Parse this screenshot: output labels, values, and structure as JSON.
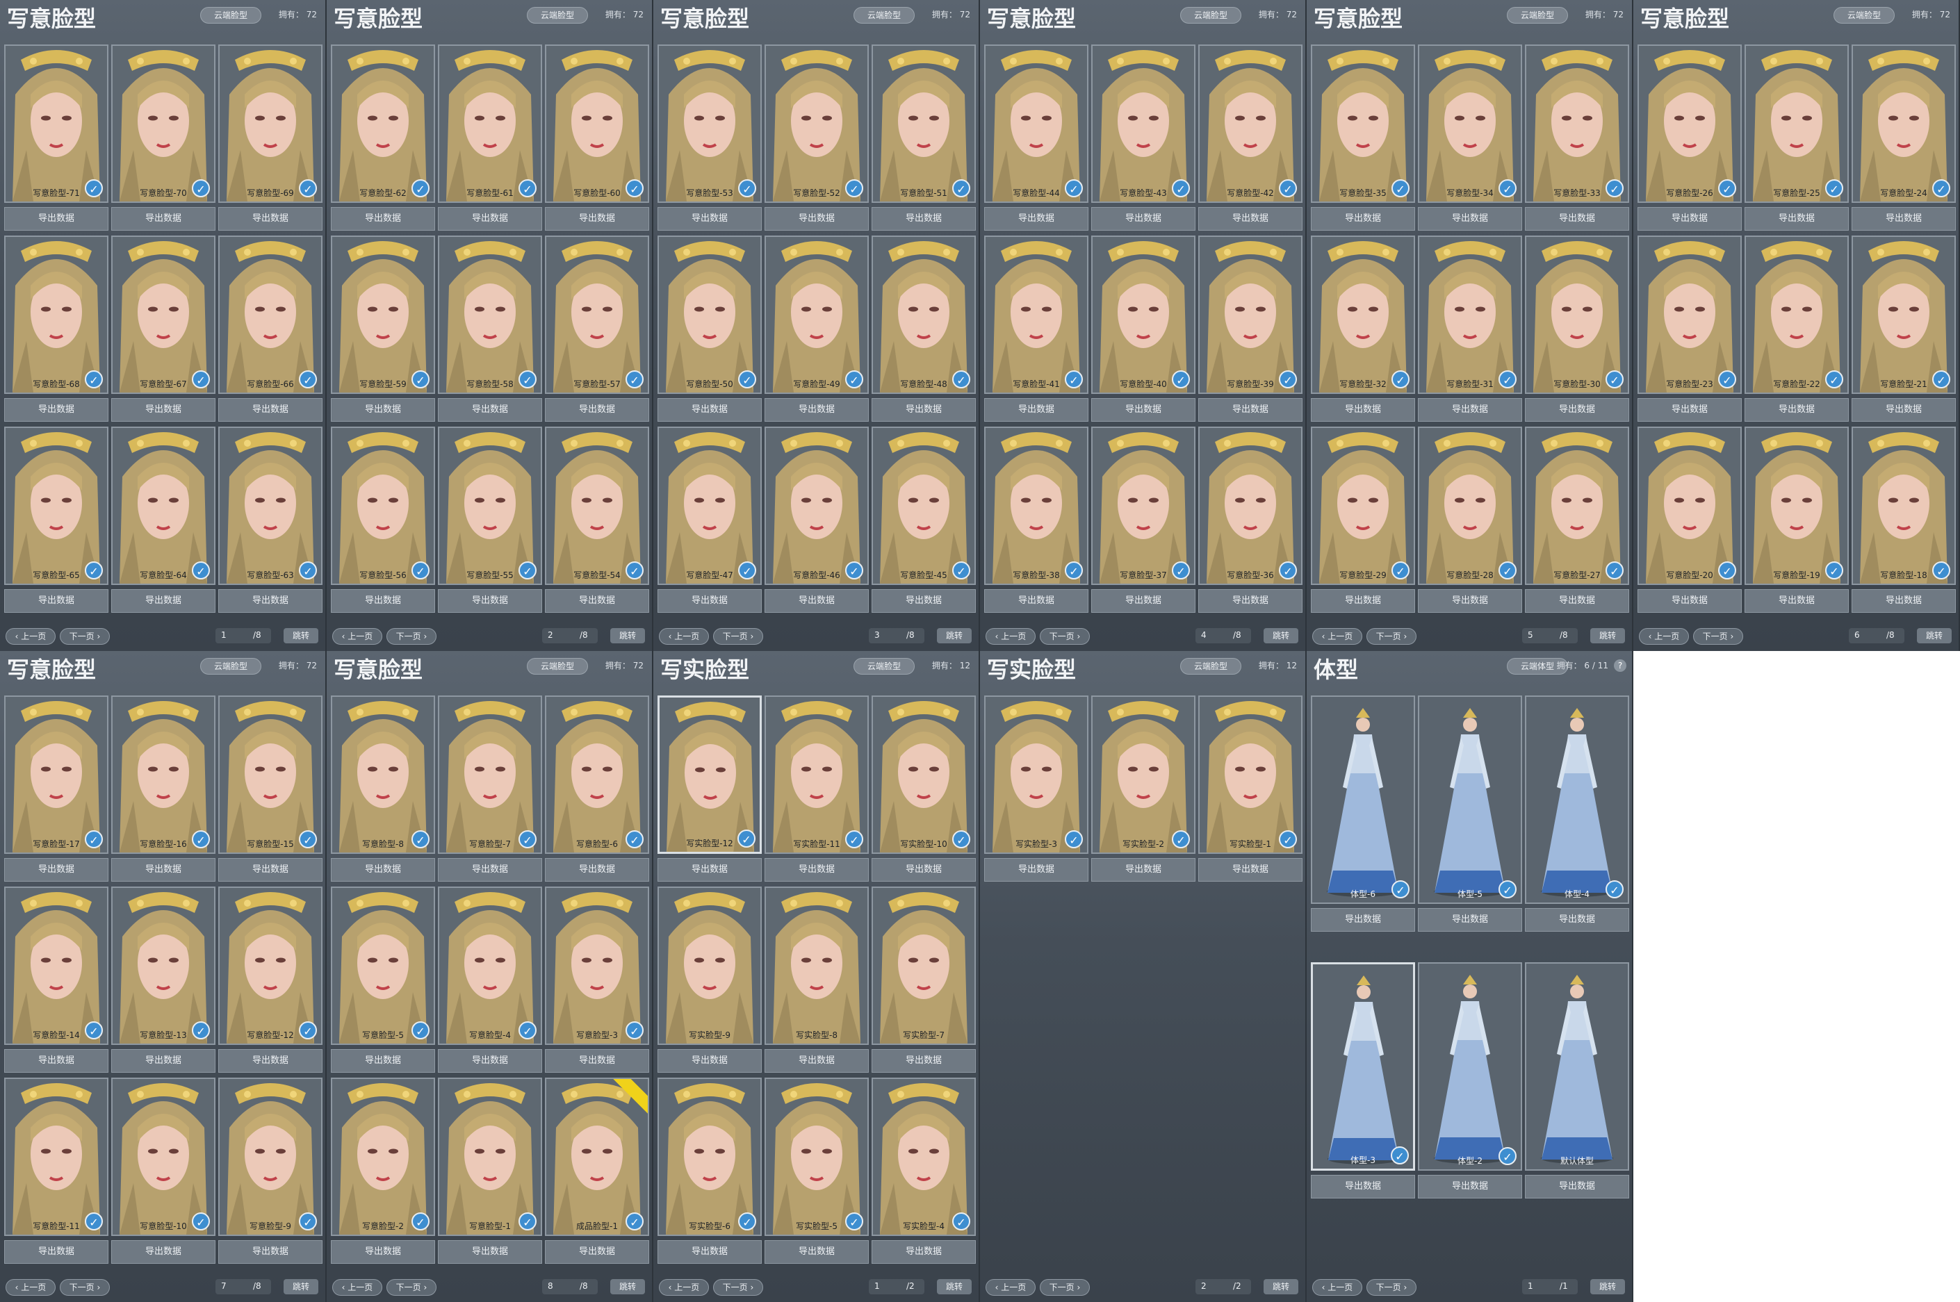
{
  "common": {
    "cloud_face_label": "云端脸型",
    "cloud_body_label": "云端体型",
    "export_label": "导出数据",
    "prev_label": "上一页",
    "next_label": "下一页",
    "jump_label": "跳转"
  },
  "colors": {
    "panel_top": "#5b6570",
    "panel_bottom": "#3a424b",
    "check_blue": "#3e8ed0",
    "new_badge": "#f0d21a"
  },
  "panels": [
    {
      "title": "写意脸型",
      "owned": "拥有： 72",
      "page": "1",
      "total": "/8",
      "type": "face",
      "items": [
        {
          "label": "写意脸型-71",
          "checked": true
        },
        {
          "label": "写意脸型-70",
          "checked": true
        },
        {
          "label": "写意脸型-69",
          "checked": true
        },
        {
          "label": "写意脸型-68",
          "checked": true
        },
        {
          "label": "写意脸型-67",
          "checked": true
        },
        {
          "label": "写意脸型-66",
          "checked": true
        },
        {
          "label": "写意脸型-65",
          "checked": true
        },
        {
          "label": "写意脸型-64",
          "checked": true
        },
        {
          "label": "写意脸型-63",
          "checked": true
        }
      ]
    },
    {
      "title": "写意脸型",
      "owned": "拥有： 72",
      "page": "2",
      "total": "/8",
      "type": "face",
      "items": [
        {
          "label": "写意脸型-62",
          "checked": true
        },
        {
          "label": "写意脸型-61",
          "checked": true
        },
        {
          "label": "写意脸型-60",
          "checked": true
        },
        {
          "label": "写意脸型-59",
          "checked": true
        },
        {
          "label": "写意脸型-58",
          "checked": true
        },
        {
          "label": "写意脸型-57",
          "checked": true
        },
        {
          "label": "写意脸型-56",
          "checked": true
        },
        {
          "label": "写意脸型-55",
          "checked": true
        },
        {
          "label": "写意脸型-54",
          "checked": true
        }
      ]
    },
    {
      "title": "写意脸型",
      "owned": "拥有： 72",
      "page": "3",
      "total": "/8",
      "type": "face",
      "items": [
        {
          "label": "写意脸型-53",
          "checked": true
        },
        {
          "label": "写意脸型-52",
          "checked": true
        },
        {
          "label": "写意脸型-51",
          "checked": true
        },
        {
          "label": "写意脸型-50",
          "checked": true
        },
        {
          "label": "写意脸型-49",
          "checked": true
        },
        {
          "label": "写意脸型-48",
          "checked": true
        },
        {
          "label": "写意脸型-47",
          "checked": true
        },
        {
          "label": "写意脸型-46",
          "checked": true
        },
        {
          "label": "写意脸型-45",
          "checked": true
        }
      ]
    },
    {
      "title": "写意脸型",
      "owned": "拥有： 72",
      "page": "4",
      "total": "/8",
      "type": "face",
      "items": [
        {
          "label": "写意脸型-44",
          "checked": true
        },
        {
          "label": "写意脸型-43",
          "checked": true
        },
        {
          "label": "写意脸型-42",
          "checked": true
        },
        {
          "label": "写意脸型-41",
          "checked": true
        },
        {
          "label": "写意脸型-40",
          "checked": true
        },
        {
          "label": "写意脸型-39",
          "checked": true
        },
        {
          "label": "写意脸型-38",
          "checked": true
        },
        {
          "label": "写意脸型-37",
          "checked": true
        },
        {
          "label": "写意脸型-36",
          "checked": true
        }
      ]
    },
    {
      "title": "写意脸型",
      "owned": "拥有： 72",
      "page": "5",
      "total": "/8",
      "type": "face",
      "items": [
        {
          "label": "写意脸型-35",
          "checked": true
        },
        {
          "label": "写意脸型-34",
          "checked": true
        },
        {
          "label": "写意脸型-33",
          "checked": true
        },
        {
          "label": "写意脸型-32",
          "checked": true
        },
        {
          "label": "写意脸型-31",
          "checked": true
        },
        {
          "label": "写意脸型-30",
          "checked": true
        },
        {
          "label": "写意脸型-29",
          "checked": true
        },
        {
          "label": "写意脸型-28",
          "checked": true
        },
        {
          "label": "写意脸型-27",
          "checked": true
        }
      ]
    },
    {
      "title": "写意脸型",
      "owned": "拥有： 72",
      "page": "6",
      "total": "/8",
      "type": "face",
      "items": [
        {
          "label": "写意脸型-26",
          "checked": true
        },
        {
          "label": "写意脸型-25",
          "checked": true
        },
        {
          "label": "写意脸型-24",
          "checked": true
        },
        {
          "label": "写意脸型-23",
          "checked": true
        },
        {
          "label": "写意脸型-22",
          "checked": true
        },
        {
          "label": "写意脸型-21",
          "checked": true
        },
        {
          "label": "写意脸型-20",
          "checked": true
        },
        {
          "label": "写意脸型-19",
          "checked": true
        },
        {
          "label": "写意脸型-18",
          "checked": true
        }
      ]
    },
    {
      "title": "写意脸型",
      "owned": "拥有： 72",
      "page": "7",
      "total": "/8",
      "type": "face",
      "items": [
        {
          "label": "写意脸型-17",
          "checked": true
        },
        {
          "label": "写意脸型-16",
          "checked": true
        },
        {
          "label": "写意脸型-15",
          "checked": true
        },
        {
          "label": "写意脸型-14",
          "checked": true
        },
        {
          "label": "写意脸型-13",
          "checked": true
        },
        {
          "label": "写意脸型-12",
          "checked": true
        },
        {
          "label": "写意脸型-11",
          "checked": true
        },
        {
          "label": "写意脸型-10",
          "checked": true
        },
        {
          "label": "写意脸型-9",
          "checked": true
        }
      ]
    },
    {
      "title": "写意脸型",
      "owned": "拥有： 72",
      "page": "8",
      "total": "/8",
      "type": "face",
      "items": [
        {
          "label": "写意脸型-8",
          "checked": true
        },
        {
          "label": "写意脸型-7",
          "checked": true
        },
        {
          "label": "写意脸型-6",
          "checked": true
        },
        {
          "label": "写意脸型-5",
          "checked": true
        },
        {
          "label": "写意脸型-4",
          "checked": true
        },
        {
          "label": "写意脸型-3",
          "checked": true
        },
        {
          "label": "写意脸型-2",
          "checked": true
        },
        {
          "label": "写意脸型-1",
          "checked": true
        },
        {
          "label": "成品脸型-1",
          "checked": true,
          "badge": true
        }
      ]
    },
    {
      "title": "写实脸型",
      "owned": "拥有： 12",
      "page": "1",
      "total": "/2",
      "type": "face",
      "items": [
        {
          "label": "写实脸型-12",
          "checked": true,
          "selected": true
        },
        {
          "label": "写实脸型-11",
          "checked": true
        },
        {
          "label": "写实脸型-10",
          "checked": true
        },
        {
          "label": "写实脸型-9",
          "checked": false
        },
        {
          "label": "写实脸型-8",
          "checked": false
        },
        {
          "label": "写实脸型-7",
          "checked": false
        },
        {
          "label": "写实脸型-6",
          "checked": true
        },
        {
          "label": "写实脸型-5",
          "checked": true
        },
        {
          "label": "写实脸型-4",
          "checked": true
        }
      ]
    },
    {
      "title": "写实脸型",
      "owned": "拥有： 12",
      "page": "2",
      "total": "/2",
      "type": "face",
      "items": [
        {
          "label": "写实脸型-3",
          "checked": true
        },
        {
          "label": "写实脸型-2",
          "checked": true
        },
        {
          "label": "写实脸型-1",
          "checked": true
        }
      ]
    },
    {
      "title": "体型",
      "owned": "拥有： 6 / 11",
      "page": "1",
      "total": "/1",
      "type": "body",
      "help": "?",
      "items": [
        {
          "label": "体型-6",
          "checked": true
        },
        {
          "label": "体型-5",
          "checked": true
        },
        {
          "label": "体型-4",
          "checked": true
        },
        {
          "label": "体型-3",
          "checked": true,
          "selected": true
        },
        {
          "label": "体型-2",
          "checked": true
        },
        {
          "label": "默认体型",
          "checked": false
        }
      ]
    }
  ]
}
